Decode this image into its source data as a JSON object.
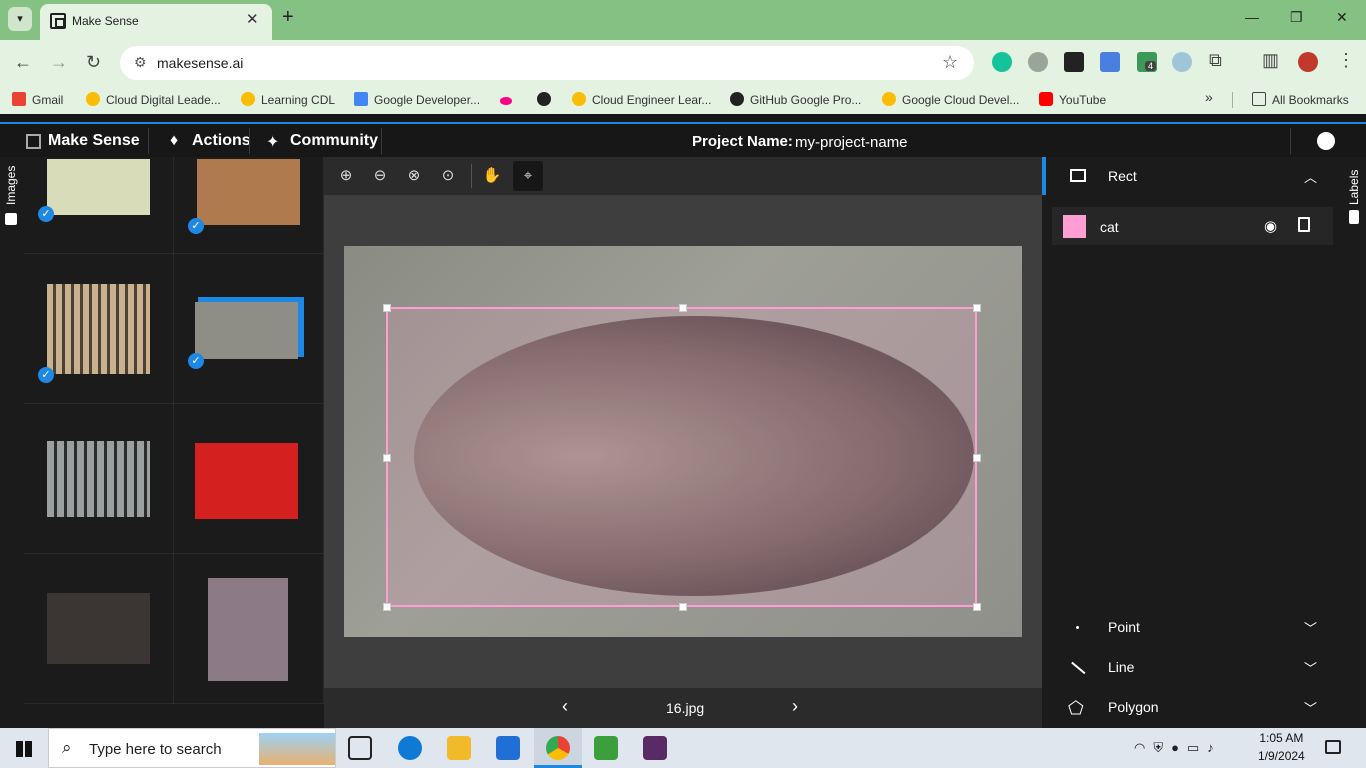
{
  "browser": {
    "tab_title": "Make Sense",
    "url": "makesense.ai",
    "ext_badge": "4",
    "bookmarks": [
      "Gmail",
      "Cloud Digital Leade...",
      "Learning CDL",
      "Google Developer...",
      "",
      "",
      "Cloud Engineer Lear...",
      "GitHub Google Pro...",
      "Google Cloud Devel...",
      "YouTube"
    ],
    "all_bookmarks": "All Bookmarks"
  },
  "app": {
    "brand": "Make Sense",
    "menu": [
      "Actions",
      "Community"
    ],
    "project_label": "Project Name:",
    "project_name": "my-project-name",
    "left_tab": "Images",
    "right_tab": "Labels",
    "current_file": "16.jpg",
    "accent": "#1e88e5",
    "label_color": "#ff9ed2"
  },
  "labels_panel": {
    "rect": "Rect",
    "label_name": "cat",
    "point": "Point",
    "line": "Line",
    "polygon": "Polygon"
  },
  "taskbar": {
    "search_placeholder": "Type here to search",
    "time": "1:05 AM",
    "date": "1/9/2024"
  }
}
